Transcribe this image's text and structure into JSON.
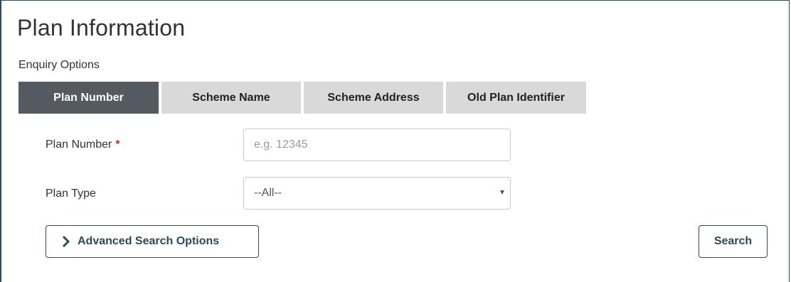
{
  "page": {
    "title": "Plan Information",
    "section_label": "Enquiry Options"
  },
  "tabs": [
    {
      "label": "Plan Number",
      "active": true
    },
    {
      "label": "Scheme Name",
      "active": false
    },
    {
      "label": "Scheme Address",
      "active": false
    },
    {
      "label": "Old Plan Identifier",
      "active": false
    }
  ],
  "form": {
    "plan_number": {
      "label": "Plan Number",
      "required_marker": "*",
      "placeholder": "e.g. 12345",
      "value": ""
    },
    "plan_type": {
      "label": "Plan Type",
      "selected": "--All--",
      "icon": "caret-down-icon"
    }
  },
  "actions": {
    "advanced_label": "Advanced Search Options",
    "advanced_icon": "chevron-right-icon",
    "search_label": "Search"
  },
  "colors": {
    "active_tab": "#555a60",
    "inactive_tab": "#d9d9d9",
    "button_border": "#2d4a57",
    "required": "#c0282e"
  }
}
